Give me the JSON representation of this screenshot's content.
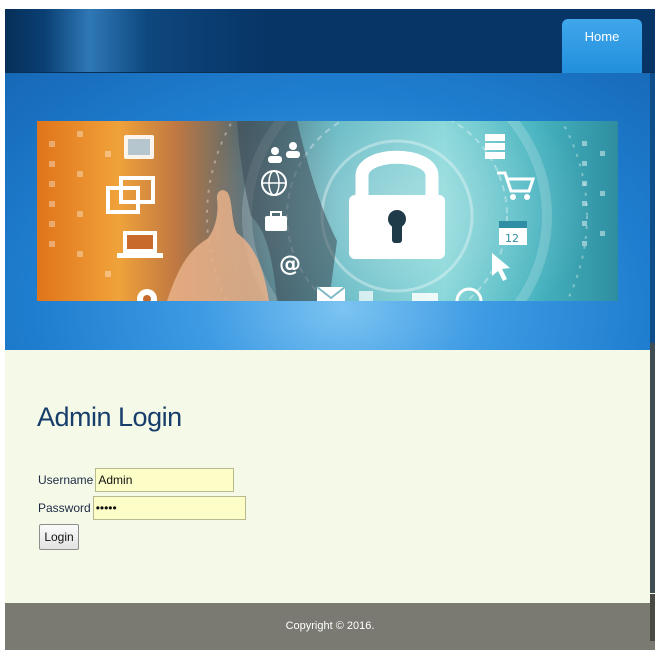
{
  "nav": {
    "home_label": "Home"
  },
  "banner": {
    "calendar_day": "12",
    "at_symbol": "@"
  },
  "login": {
    "title": "Admin Login",
    "username_label": "Username",
    "username_value": "Admin",
    "password_label": "Password",
    "password_value": "admin",
    "button_label": "Login"
  },
  "footer": {
    "copyright": "Copyright © 2016."
  },
  "colors": {
    "header_navy": "#073566",
    "tab_blue": "#228fdc",
    "banner_blue": "#1f7dcf",
    "content_bg": "#f5f9e8",
    "title_color": "#173d6b",
    "input_bg": "#fdfdc8",
    "footer_gray": "#7a7a72"
  }
}
